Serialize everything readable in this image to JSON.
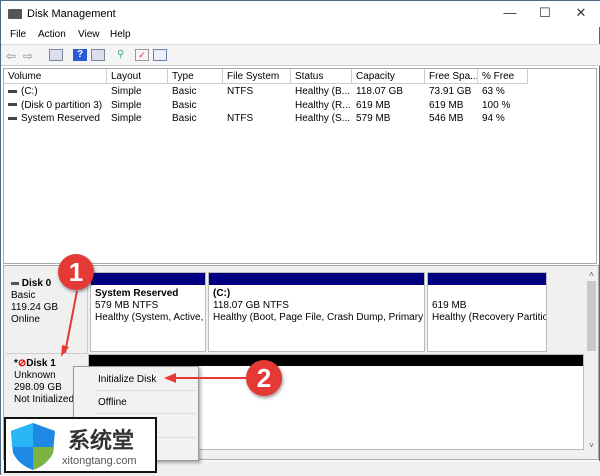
{
  "window": {
    "title": "Disk Management",
    "minimize": "—",
    "maximize": "☐",
    "close": "✕"
  },
  "menu": [
    "File",
    "Action",
    "View",
    "Help"
  ],
  "table": {
    "columns": [
      "Volume",
      "Layout",
      "Type",
      "File System",
      "Status",
      "Capacity",
      "Free Spa...",
      "% Free"
    ],
    "rows": [
      [
        "(C:)",
        "Simple",
        "Basic",
        "NTFS",
        "Healthy (B...",
        "118.07 GB",
        "73.91 GB",
        "63 %"
      ],
      [
        "(Disk 0 partition 3)",
        "Simple",
        "Basic",
        "",
        "Healthy (R...",
        "619 MB",
        "619 MB",
        "100 %"
      ],
      [
        "System Reserved",
        "Simple",
        "Basic",
        "NTFS",
        "Healthy (S...",
        "579 MB",
        "546 MB",
        "94 %"
      ]
    ]
  },
  "disk0": {
    "name": "Disk 0",
    "type": "Basic",
    "size": "119.24 GB",
    "state": "Online",
    "partitions": [
      {
        "name": "System Reserved",
        "size": "579 MB NTFS",
        "status": "Healthy (System, Active, P"
      },
      {
        "name": "(C:)",
        "size": "118.07 GB NTFS",
        "status": "Healthy (Boot, Page File, Crash Dump, Primary Pa"
      },
      {
        "name": "",
        "size": "619 MB",
        "status": "Healthy (Recovery Partitio"
      }
    ]
  },
  "disk1": {
    "prefix": "*",
    "name": "Disk 1",
    "type": "Unknown",
    "size": "298.09 GB",
    "state": "Not Initialized"
  },
  "context_menu": {
    "items": [
      "Initialize Disk",
      "Offline"
    ]
  },
  "callouts": [
    "1",
    "2"
  ],
  "watermark": {
    "name": "系统堂",
    "url": "xitongtang.com"
  },
  "colors": {
    "partition_bar": "#000080",
    "callout": "#e53935"
  }
}
